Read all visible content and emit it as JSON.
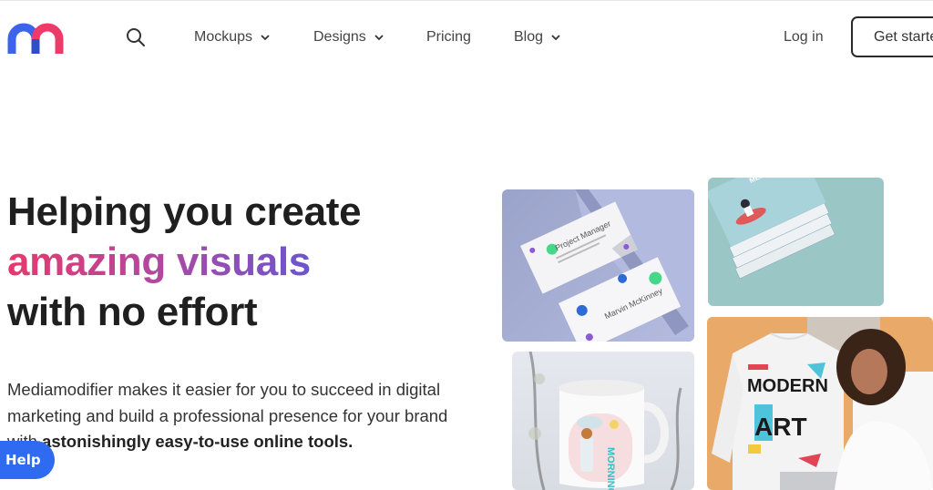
{
  "brand": {
    "name": "mediamodifier-logo",
    "colors": {
      "blue": "#3d63ea",
      "pink": "#ee3a69"
    }
  },
  "nav": {
    "search_icon": "search-icon",
    "items": [
      {
        "label": "Mockups",
        "has_dropdown": true
      },
      {
        "label": "Designs",
        "has_dropdown": true
      },
      {
        "label": "Pricing",
        "has_dropdown": false
      },
      {
        "label": "Blog",
        "has_dropdown": true
      }
    ],
    "login_label": "Log in",
    "cta_label": "Get started"
  },
  "hero": {
    "title_line1": "Helping you create",
    "title_line2": "amazing visuals",
    "title_line3": "with no effort",
    "gradient_colors": [
      "#e8386d",
      "#6a55d0"
    ],
    "desc_plain": "Mediamodifier makes it easier for you to succeed in digital marketing and build a professional presence for your brand with ",
    "desc_bold": "astonishingly easy-to-use online tools."
  },
  "showcase": {
    "tiles": [
      {
        "name": "business-card-mockup",
        "card1_title": "Project Manager",
        "card2_title": "Marvin McKinney"
      },
      {
        "name": "book-mockup",
        "cover_title": "MEDITATION"
      },
      {
        "name": "mug-mockup",
        "mug_text": "MORNING"
      },
      {
        "name": "sweatshirt-mockup",
        "shirt_text_1": "MODERN",
        "shirt_text_2": "ART"
      }
    ]
  },
  "help_widget": {
    "label": "Help",
    "color": "#2f6bf0"
  }
}
